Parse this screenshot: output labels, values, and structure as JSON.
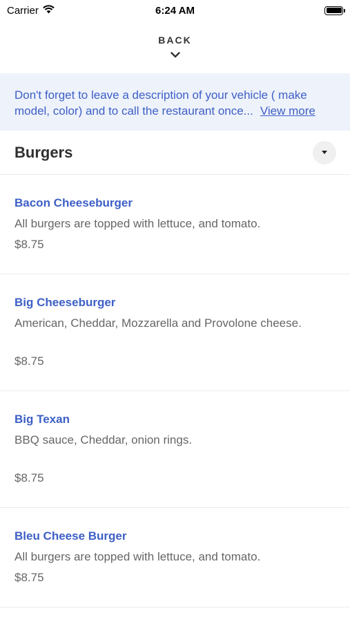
{
  "status_bar": {
    "carrier": "Carrier",
    "time": "6:24 AM",
    "battery_level": 1.0
  },
  "header": {
    "back_label": "BACK",
    "back_icon": "chevron-down-icon"
  },
  "notice": {
    "line1": "Don't forget to leave a description of your vehicle ( make",
    "line2": "model, color) and to call the restaurant once...",
    "more_label": "View more"
  },
  "section": {
    "title": "Burgers",
    "toggle_icon": "caret-down-icon"
  },
  "items": [
    {
      "name": "Bacon Cheeseburger",
      "description": "All burgers are topped with lettuce, and tomato.",
      "price": "$8.75"
    },
    {
      "name": "Big Cheeseburger",
      "description": "American, Cheddar, Mozzarella and Provolone cheese.",
      "price": "$8.75"
    },
    {
      "name": "Big Texan",
      "description": "BBQ sauce, Cheddar, onion rings.",
      "price": "$8.75"
    },
    {
      "name": "Bleu Cheese Burger",
      "description": "All burgers are topped with lettuce, and tomato.",
      "price": "$8.75"
    }
  ],
  "colors": {
    "accent": "#3d5fc6",
    "notice_bg": "#eef2fb",
    "text_muted": "#666666"
  }
}
